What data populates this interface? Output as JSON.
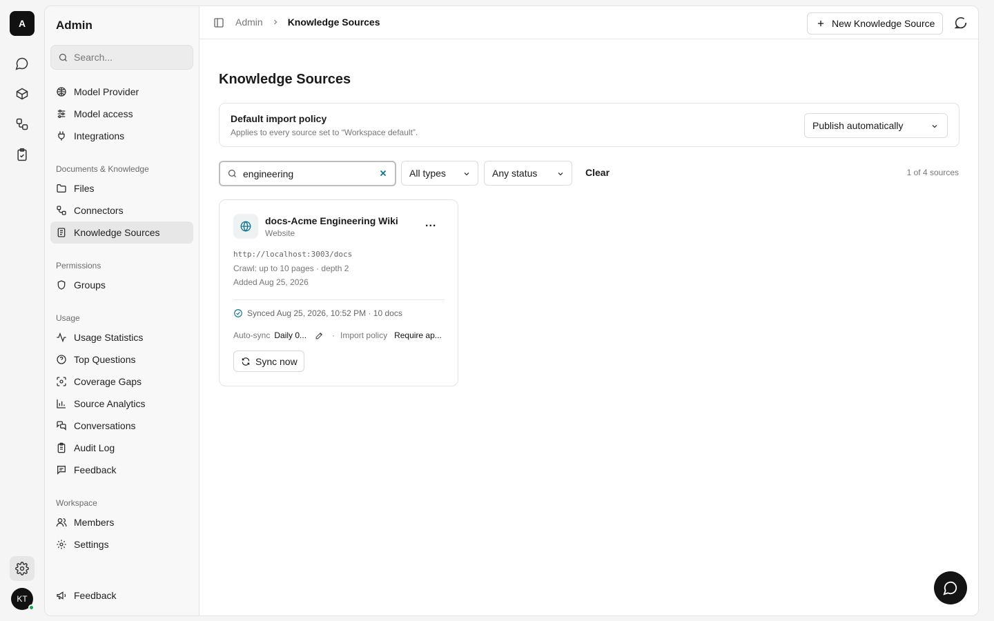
{
  "rail": {
    "logo_letter": "A",
    "items": [
      "chat-icon",
      "box-icon",
      "workflow-icon",
      "clipboard-check-icon"
    ],
    "settings_icon": "gear-icon",
    "avatar_initials": "KT"
  },
  "sidebar": {
    "title": "Admin",
    "search_placeholder": "Search...",
    "top_items": [
      {
        "label": "Model Provider",
        "icon": "brain-icon"
      },
      {
        "label": "Model access",
        "icon": "sliders-icon"
      },
      {
        "label": "Integrations",
        "icon": "plug-icon"
      }
    ],
    "groups": [
      {
        "label": "Documents & Knowledge",
        "items": [
          {
            "label": "Files",
            "icon": "folder-icon"
          },
          {
            "label": "Connectors",
            "icon": "connector-icon"
          },
          {
            "label": "Knowledge Sources",
            "icon": "book-icon",
            "active": true
          }
        ]
      },
      {
        "label": "Permissions",
        "items": [
          {
            "label": "Groups",
            "icon": "shield-icon"
          }
        ]
      },
      {
        "label": "Usage",
        "items": [
          {
            "label": "Usage Statistics",
            "icon": "activity-icon"
          },
          {
            "label": "Top Questions",
            "icon": "question-icon"
          },
          {
            "label": "Coverage Gaps",
            "icon": "scan-icon"
          },
          {
            "label": "Source Analytics",
            "icon": "bar-chart-icon"
          },
          {
            "label": "Conversations",
            "icon": "messages-icon"
          },
          {
            "label": "Audit Log",
            "icon": "clipboard-list-icon"
          },
          {
            "label": "Feedback",
            "icon": "message-square-icon"
          }
        ]
      },
      {
        "label": "Workspace",
        "items": [
          {
            "label": "Members",
            "icon": "users-icon"
          },
          {
            "label": "Settings",
            "icon": "gear-icon"
          }
        ]
      }
    ],
    "footer_item": {
      "label": "Feedback",
      "icon": "megaphone-icon"
    }
  },
  "topbar": {
    "breadcrumb": [
      "Admin",
      "Knowledge Sources"
    ],
    "new_button_label": "New Knowledge Source"
  },
  "page": {
    "title": "Knowledge Sources",
    "policy": {
      "title": "Default import policy",
      "subtitle": "Applies to every source set to “Workspace default”.",
      "selected": "Publish automatically"
    },
    "filters": {
      "search_value": "engineering",
      "type_selected": "All types",
      "status_selected": "Any status",
      "clear_label": "Clear",
      "result_count": "1 of 4 sources"
    },
    "sources": [
      {
        "name": "docs-Acme Engineering Wiki",
        "type": "Website",
        "url": "http://localhost:3003/docs",
        "crawl": "Crawl: up to 10 pages · depth 2",
        "added": "Added Aug 25, 2026",
        "synced": "Synced Aug 25, 2026, 10:52 PM · 10 docs",
        "auto_sync_label": "Auto-sync",
        "auto_sync_value": "Daily 0...",
        "policy_label": "Import policy",
        "policy_value": "Require ap...",
        "sync_button": "Sync now",
        "more_label": "..."
      }
    ]
  },
  "colors": {
    "accent": "#0e7490",
    "dark": "#141414",
    "active_bg": "#e7e7e7"
  }
}
